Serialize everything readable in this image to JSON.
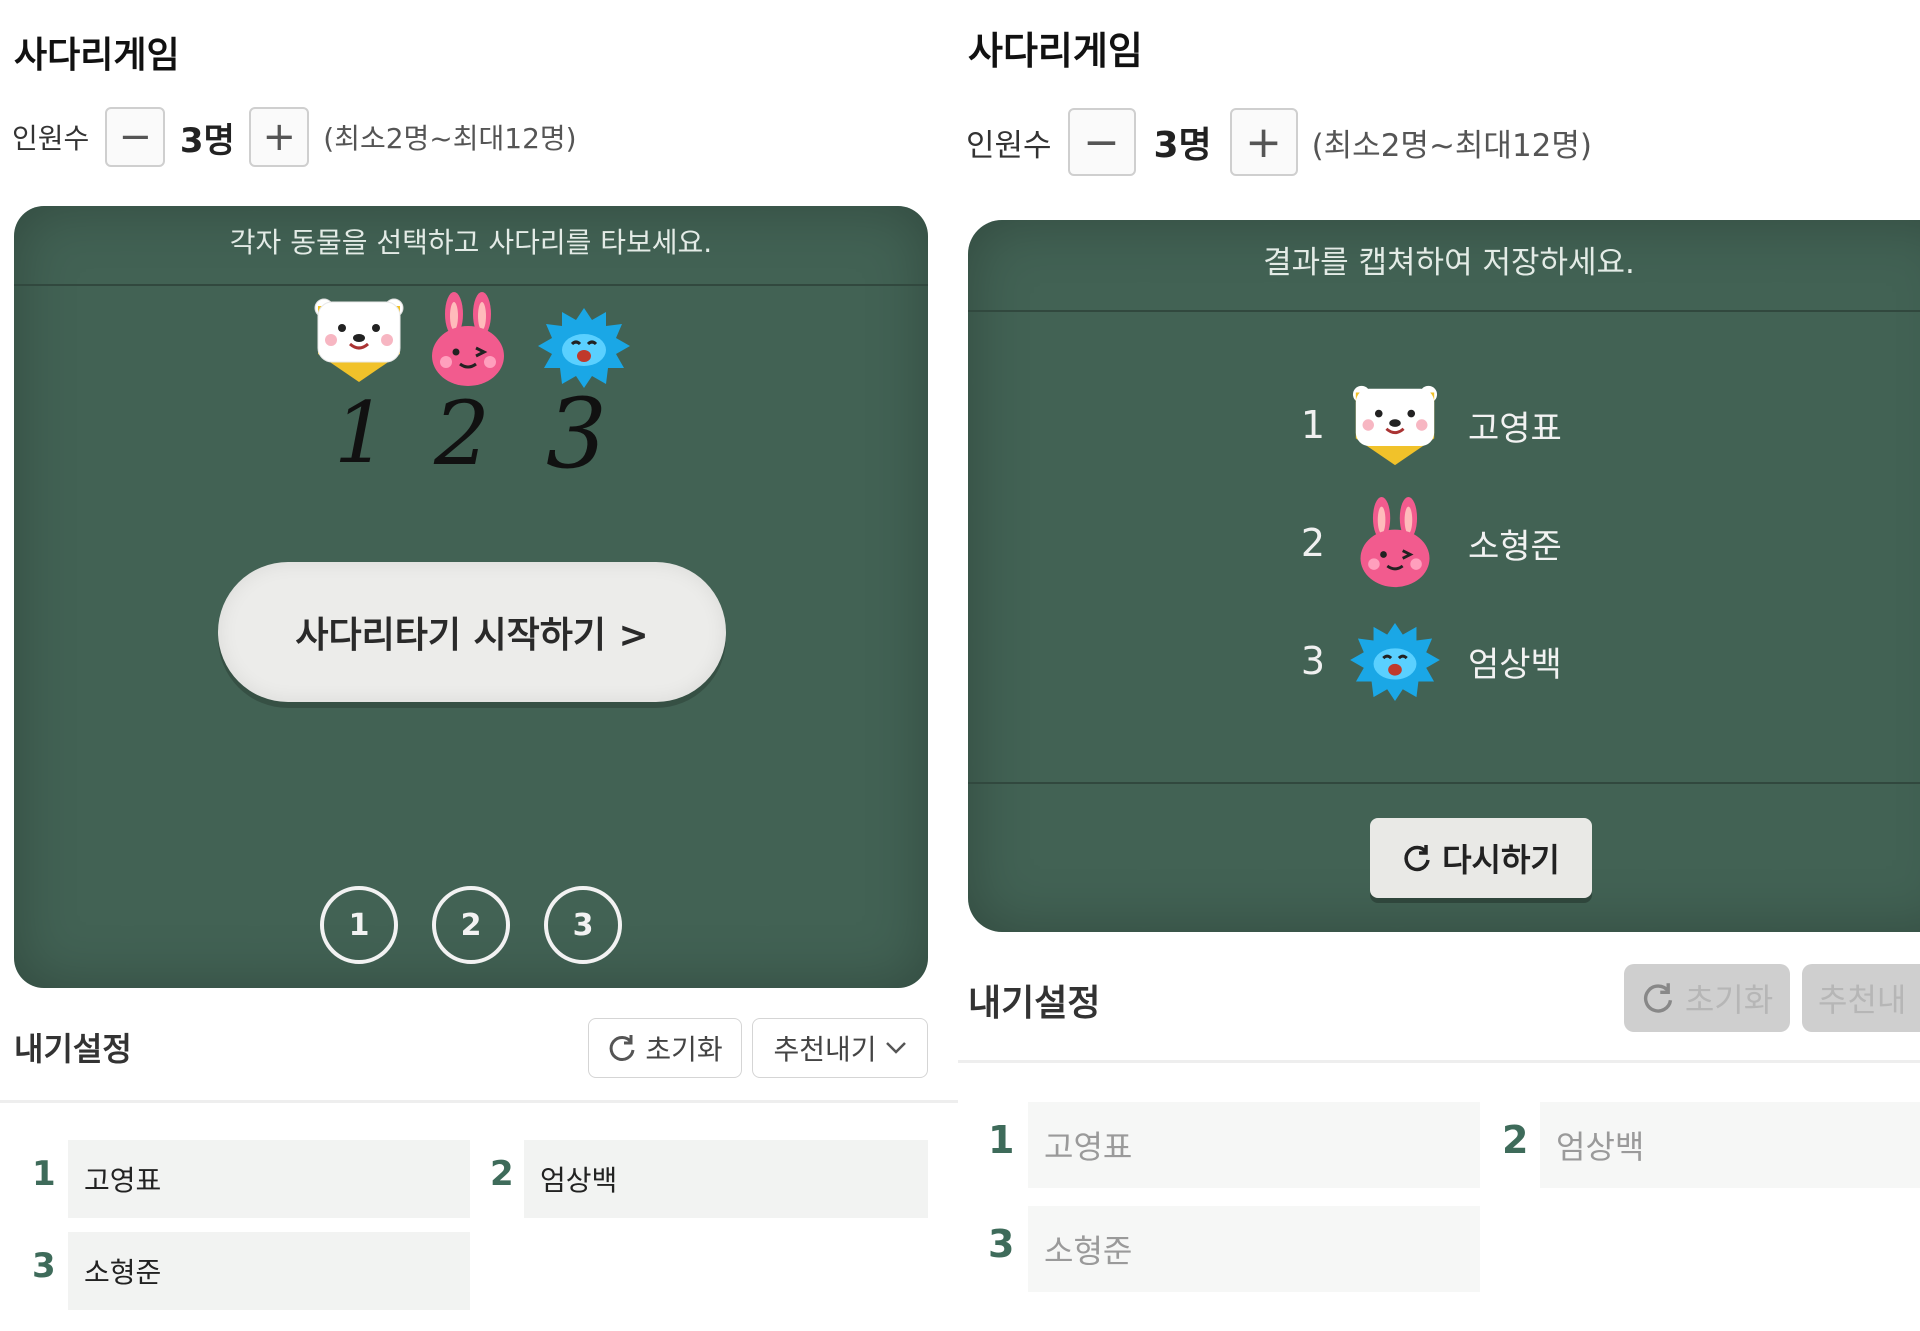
{
  "left": {
    "title": "사다리게임",
    "count_label": "인원수",
    "minus_label": "−",
    "count_value": "3명",
    "plus_label": "+",
    "count_range": "(최소2명~최대12명)",
    "board_message": "각자 동물을 선택하고 사다리를 타보세요.",
    "animals": [
      "bear-icon",
      "rabbit-icon",
      "hedgehog-icon"
    ],
    "handwritten_numbers": [
      "1",
      "2",
      "3"
    ],
    "start_button": "사다리타기 시작하기 >",
    "bottom_numbers": [
      "1",
      "2",
      "3"
    ],
    "settings_title": "내기설정",
    "reset_label": "초기화",
    "recommend_label": "추천내기",
    "entries": [
      {
        "num": "1",
        "name": "고영표"
      },
      {
        "num": "2",
        "name": "엄상백"
      },
      {
        "num": "3",
        "name": "소형준"
      }
    ]
  },
  "right": {
    "title": "사다리게임",
    "count_label": "인원수",
    "minus_label": "−",
    "count_value": "3명",
    "plus_label": "+",
    "count_range": "(최소2명~최대12명)",
    "board_message": "결과를 캡쳐하여 저장하세요.",
    "results": [
      {
        "num": "1",
        "animal": "bear-icon",
        "name": "고영표"
      },
      {
        "num": "2",
        "animal": "rabbit-icon",
        "name": "소형준"
      },
      {
        "num": "3",
        "animal": "hedgehog-icon",
        "name": "엄상백"
      }
    ],
    "retry_button": "다시하기",
    "settings_title": "내기설정",
    "reset_label": "초기화",
    "recommend_label": "추천내",
    "entries": [
      {
        "num": "1",
        "name": "고영표"
      },
      {
        "num": "2",
        "name": "엄상백"
      },
      {
        "num": "3",
        "name": "소형준"
      }
    ]
  },
  "colors": {
    "board": "#426254",
    "accent_number": "#3e6b5a"
  }
}
